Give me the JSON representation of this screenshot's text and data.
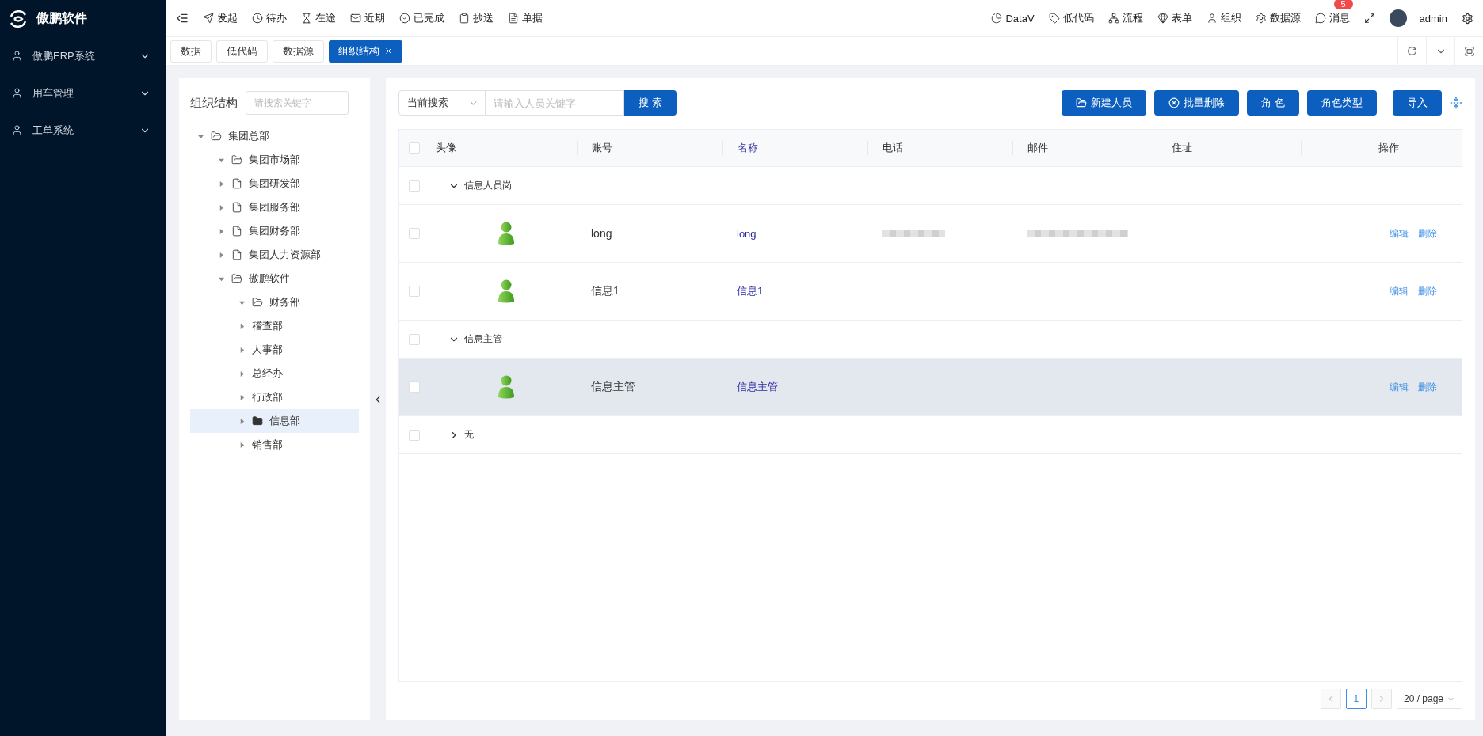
{
  "sidebar": {
    "brand": "傲鹏软件",
    "items": [
      {
        "label": "傲鹏ERP系统",
        "expanded": false
      },
      {
        "label": "用车管理",
        "expanded": false
      },
      {
        "label": "工单系统",
        "expanded": false
      }
    ]
  },
  "topbar": {
    "nav": [
      "发起",
      "待办",
      "在途",
      "近期",
      "已完成",
      "抄送",
      "单据"
    ],
    "links": [
      "DataV",
      "低代码",
      "流程",
      "表单",
      "组织",
      "数据源",
      "消息"
    ],
    "message_badge": "5",
    "user": "admin"
  },
  "tabs": [
    {
      "label": "数据",
      "selected": false,
      "closable": false
    },
    {
      "label": "低代码",
      "selected": false,
      "closable": false
    },
    {
      "label": "数据源",
      "selected": false,
      "closable": false
    },
    {
      "label": "组织结构",
      "selected": true,
      "closable": true
    }
  ],
  "org_panel": {
    "title": "组织结构",
    "search": {
      "placeholder": "请搜索关键字"
    },
    "tree": [
      {
        "label": "集团总部",
        "kind": "folder",
        "expanded": true,
        "selected": false,
        "children": [
          {
            "label": "集团市场部",
            "kind": "folder",
            "expanded": true,
            "selected": false
          },
          {
            "label": "集团研发部",
            "kind": "file",
            "expanded": false,
            "selected": false
          },
          {
            "label": "集团服务部",
            "kind": "file",
            "expanded": false,
            "selected": false
          },
          {
            "label": "集团财务部",
            "kind": "file",
            "expanded": false,
            "selected": false
          },
          {
            "label": "集团人力资源部",
            "kind": "file",
            "expanded": false,
            "selected": false
          },
          {
            "label": "傲鹏软件",
            "kind": "folder",
            "expanded": true,
            "selected": false,
            "children": [
              {
                "label": "财务部",
                "kind": "folder",
                "expanded": true,
                "selected": false
              },
              {
                "label": "稽查部",
                "kind": "plain",
                "expanded": false,
                "selected": false
              },
              {
                "label": "人事部",
                "kind": "plain",
                "expanded": false,
                "selected": false
              },
              {
                "label": "总经办",
                "kind": "plain",
                "expanded": false,
                "selected": false
              },
              {
                "label": "行政部",
                "kind": "plain",
                "expanded": false,
                "selected": false
              },
              {
                "label": "信息部",
                "kind": "folder",
                "expanded": false,
                "selected": true
              },
              {
                "label": "销售部",
                "kind": "plain",
                "expanded": false,
                "selected": false
              }
            ]
          }
        ]
      }
    ]
  },
  "toolbar": {
    "scope": "当前搜索",
    "search": {
      "placeholder": "请输入人员关键字"
    },
    "search_button": "搜 索",
    "buttons": [
      "新建人员",
      "批量删除",
      "角 色",
      "角色类型",
      "导入"
    ]
  },
  "table": {
    "all_checked": false,
    "columns": [
      {
        "label": "头像",
        "accent": false
      },
      {
        "label": "账号",
        "accent": false
      },
      {
        "label": "名称",
        "accent": true
      },
      {
        "label": "电话",
        "accent": false
      },
      {
        "label": "邮件",
        "accent": false
      },
      {
        "label": "住址",
        "accent": false
      },
      {
        "label": "操作",
        "accent": false
      }
    ],
    "rows": [
      {
        "kind": "group",
        "label": "信息人员岗",
        "expanded": true,
        "checked": false,
        "highlighted": false
      },
      {
        "kind": "person",
        "account": "long",
        "name": "long",
        "phone_redacted": true,
        "email_redacted": true,
        "actions": [
          "编辑",
          "删除"
        ],
        "checked": false,
        "highlighted": false
      },
      {
        "kind": "person",
        "account": "信息1",
        "name": "信息1",
        "phone_redacted": false,
        "email_redacted": false,
        "actions": [
          "编辑",
          "删除"
        ],
        "checked": false,
        "highlighted": false
      },
      {
        "kind": "group",
        "label": "信息主管",
        "expanded": true,
        "checked": false,
        "highlighted": false
      },
      {
        "kind": "person",
        "account": "信息主管",
        "name": "信息主管",
        "phone_redacted": false,
        "email_redacted": false,
        "actions": [
          "编辑",
          "删除"
        ],
        "checked": false,
        "highlighted": true
      },
      {
        "kind": "group",
        "label": "无",
        "expanded": false,
        "checked": false,
        "highlighted": false
      }
    ]
  },
  "pagination": {
    "pages": [
      {
        "label": "1",
        "selected": true
      }
    ],
    "page_size": "20 / page"
  }
}
